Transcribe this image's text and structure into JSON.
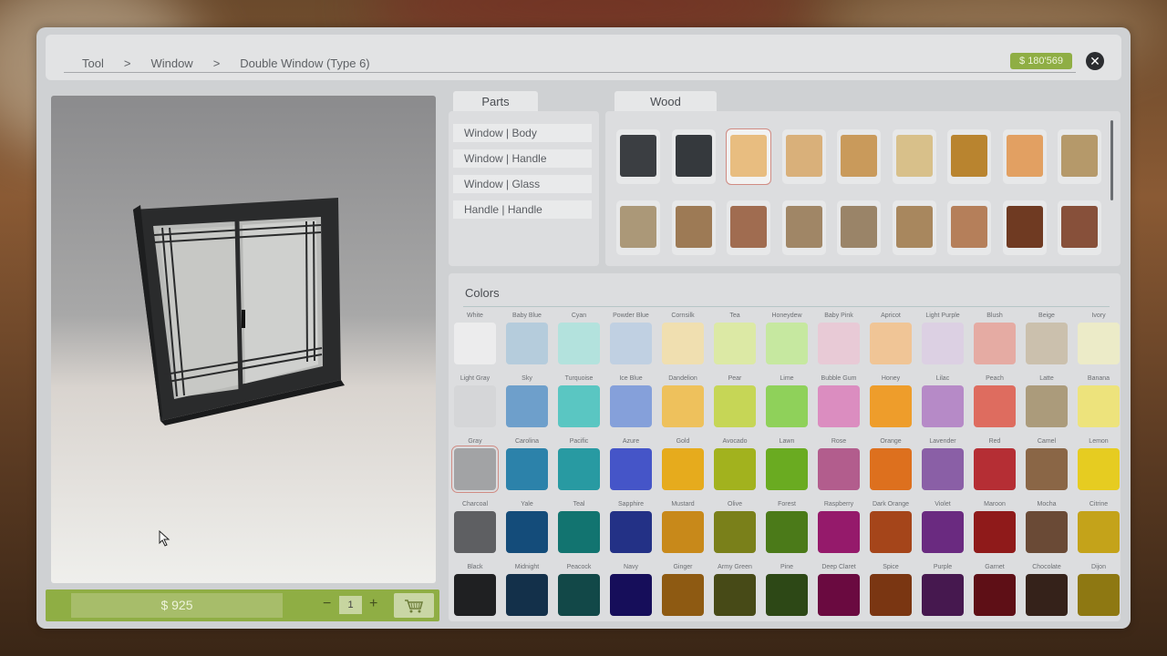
{
  "breadcrumb": [
    "Tool",
    ">",
    "Window",
    ">",
    "Double Window (Type 6)"
  ],
  "balance": "$ 180'569",
  "close_icon": "close-icon",
  "buy": {
    "price": "$ 925",
    "minus": "−",
    "quantity": "1",
    "plus": "+",
    "cart_icon": "shopping-cart-icon"
  },
  "tabs": {
    "parts": "Parts",
    "wood": "Wood"
  },
  "parts": [
    "Window | Body",
    "Window | Handle",
    "Window | Glass",
    "Handle | Handle"
  ],
  "wood_swatches": [
    [
      "#3b3e42",
      "#35393d",
      "#e8bd80",
      "#d9b07a",
      "#c99a5b",
      "#d8c08a",
      "#b9842f",
      "#e2a062",
      "#b5996a"
    ],
    [
      "#ab9878",
      "#9d7a55",
      "#a06c50",
      "#a08666",
      "#9a8468",
      "#a8875e",
      "#b57f5a",
      "#6f3a22",
      "#87503a"
    ]
  ],
  "wood_selected": [
    0,
    2
  ],
  "colors_title": "Colors",
  "colors": [
    [
      [
        "White",
        "#ececed"
      ],
      [
        "Baby Blue",
        "#b5ccdc"
      ],
      [
        "Cyan",
        "#b3e2dd"
      ],
      [
        "Powder Blue",
        "#c0d0e2"
      ],
      [
        "Cornsilk",
        "#f0dfb0"
      ],
      [
        "Tea",
        "#dce9a5"
      ],
      [
        "Honeydew",
        "#c6e8a0"
      ],
      [
        "Baby Pink",
        "#e8cad6"
      ],
      [
        "Apricot",
        "#f0c596"
      ],
      [
        "Light Purple",
        "#dcd0e3"
      ],
      [
        "Blush",
        "#e5aba3"
      ],
      [
        "Beige",
        "#cbc0ad"
      ],
      [
        "Ivory",
        "#ecebc8"
      ]
    ],
    [
      [
        "Light Gray",
        "#d5d6d8"
      ],
      [
        "Sky",
        "#6e9fcb"
      ],
      [
        "Turquoise",
        "#5ac6c2"
      ],
      [
        "Ice Blue",
        "#85a0da"
      ],
      [
        "Dandelion",
        "#eec15c"
      ],
      [
        "Pear",
        "#c6d656"
      ],
      [
        "Lime",
        "#8fd15a"
      ],
      [
        "Bubble Gum",
        "#db8dc0"
      ],
      [
        "Honey",
        "#ee9d2b"
      ],
      [
        "Lilac",
        "#b68ac7"
      ],
      [
        "Peach",
        "#de6c5f"
      ],
      [
        "Latte",
        "#ab9b7b"
      ],
      [
        "Banana",
        "#ede37c"
      ]
    ],
    [
      [
        "Gray",
        "#a2a3a5"
      ],
      [
        "Carolina",
        "#2c82aa"
      ],
      [
        "Pacific",
        "#289aa2"
      ],
      [
        "Azure",
        "#4555c8"
      ],
      [
        "Gold",
        "#e6ab1d"
      ],
      [
        "Avocado",
        "#a2b21e"
      ],
      [
        "Lawn",
        "#6aab21"
      ],
      [
        "Rose",
        "#b25d8d"
      ],
      [
        "Orange",
        "#dd701e"
      ],
      [
        "Lavender",
        "#8a5fa6"
      ],
      [
        "Red",
        "#b52e34"
      ],
      [
        "Camel",
        "#8a6646"
      ],
      [
        "Lemon",
        "#e6cc21"
      ]
    ],
    [
      [
        "Charcoal",
        "#5e5f62"
      ],
      [
        "Yale",
        "#144c7a"
      ],
      [
        "Teal",
        "#127470"
      ],
      [
        "Sapphire",
        "#233186"
      ],
      [
        "Mustard",
        "#c8891a"
      ],
      [
        "Olive",
        "#7a801a"
      ],
      [
        "Forest",
        "#4b7a19"
      ],
      [
        "Raspberry",
        "#951a6b"
      ],
      [
        "Dark Orange",
        "#a5451a"
      ],
      [
        "Violet",
        "#6a2a80"
      ],
      [
        "Maroon",
        "#8f1a1a"
      ],
      [
        "Mocha",
        "#6a4a36"
      ],
      [
        "Citrine",
        "#c4a31a"
      ]
    ],
    [
      [
        "Black",
        "#1f2022"
      ],
      [
        "Midnight",
        "#13304a"
      ],
      [
        "Peacock",
        "#124848"
      ],
      [
        "Navy",
        "#160e5a"
      ],
      [
        "Ginger",
        "#8e5a12"
      ],
      [
        "Army Green",
        "#474a17"
      ],
      [
        "Pine",
        "#2d4816"
      ],
      [
        "Deep Claret",
        "#6a0a40"
      ],
      [
        "Spice",
        "#7a3612"
      ],
      [
        "Purple",
        "#46184f"
      ],
      [
        "Garnet",
        "#5e0f16"
      ],
      [
        "Chocolate",
        "#35221a"
      ],
      [
        "Dijon",
        "#8e7812"
      ]
    ]
  ],
  "colors_selected": [
    2,
    0
  ]
}
